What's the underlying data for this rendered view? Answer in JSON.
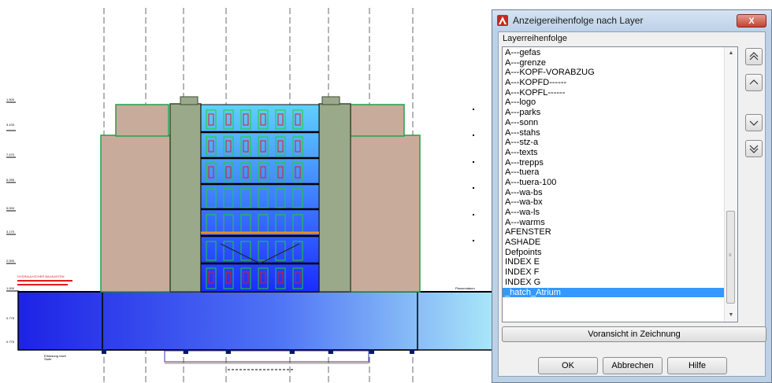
{
  "drawing": {
    "elevation_labels": [
      "1.500",
      "3.100",
      "7.470",
      "6.265",
      "5.000",
      "3.170",
      "2.000",
      "1.000",
      "0.775",
      "0.775"
    ],
    "annotation_left": "Erfassung nach",
    "annotation_left2": "Stufe",
    "annotation_right": "Planumdatum",
    "annotation_red": "HYDRAULISCHER BAUKASTEN"
  },
  "dialog": {
    "title": "Anzeigereihenfolge nach Layer",
    "close_label": "X",
    "group_label": "Layerreihenfolge",
    "layers": [
      "A---gefas",
      "A---grenze",
      "A---KOPF-VORABZUG",
      "A---KOPFD------",
      "A---KOPFL------",
      "A---logo",
      "A---parks",
      "A---sonn",
      "A---stahs",
      "A---stz-a",
      "A---texts",
      "A---trepps",
      "A---tuera",
      "A---tuera-100",
      "A---wa-bs",
      "A---wa-bx",
      "A---wa-ls",
      "A---warms",
      "AFENSTER",
      "ASHADE",
      "Defpoints",
      "INDEX E",
      "INDEX F",
      "INDEX G",
      "_hatch_Atrium"
    ],
    "selected_index": 24,
    "preview_button": "Voransicht in Zeichnung",
    "ok_button": "OK",
    "cancel_button": "Abbrechen",
    "help_button": "Hilfe",
    "side_buttons": [
      "move-to-top-icon",
      "move-up-icon",
      "move-down-icon",
      "move-to-bottom-icon"
    ]
  },
  "colors": {
    "dialog_frame": "#bcd0e6",
    "selection": "#3399ff",
    "close_button": "#c4432f",
    "facade_blue": "#1f3cff",
    "stone": "#c9ab9c"
  }
}
